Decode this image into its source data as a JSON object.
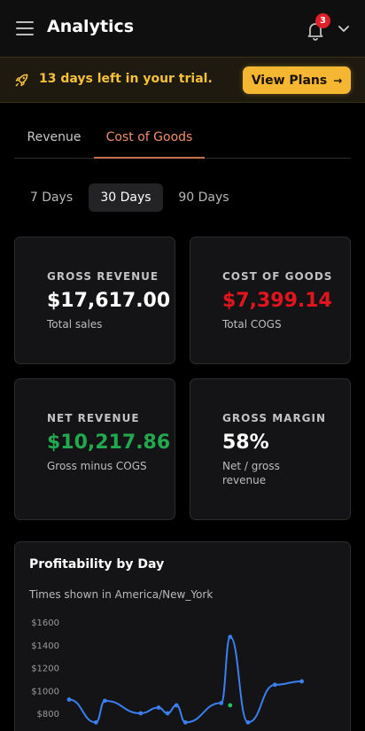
{
  "header": {
    "title": "Analytics",
    "notification_count": "3",
    "icons": {
      "menu": "menu-icon",
      "bell": "bell-icon",
      "chevron": "chevron-down-icon"
    }
  },
  "trial": {
    "message": "13 days left in your trial.",
    "button_label": "View Plans",
    "button_arrow": "→",
    "icon": "rocket-icon"
  },
  "tabs": [
    {
      "label": "Revenue",
      "active": false
    },
    {
      "label": "Cost of Goods",
      "active": true
    }
  ],
  "ranges": [
    {
      "label": "7 Days",
      "active": false
    },
    {
      "label": "30 Days",
      "active": true
    },
    {
      "label": "90 Days",
      "active": false
    }
  ],
  "metrics": [
    {
      "label": "GROSS REVENUE",
      "value": "$17,617.00",
      "sub": "Total sales"
    },
    {
      "label": "COST OF GOODS",
      "value": "$7,399.14",
      "sub": "Total COGS"
    },
    {
      "label": "NET REVENUE",
      "value": "$10,217.86",
      "sub": "Gross minus COGS"
    },
    {
      "label": "GROSS MARGIN",
      "value": "58%",
      "sub": "Net / gross revenue"
    }
  ],
  "colors": {
    "accent": "#f5b731",
    "tab_active": "#f0906a",
    "negative": "#e3141d",
    "positive": "#22a94f",
    "series_blue": "#3b7ff0",
    "series_green": "#22c55e"
  },
  "chart": {
    "title": "Profitability by Day",
    "timezone_note": "Times shown in America/New_York"
  },
  "chart_data": {
    "type": "line",
    "title": "Profitability by Day",
    "y_tick_labels": [
      "$1600",
      "$1400",
      "$1200",
      "$1000",
      "$800"
    ],
    "ylim_visible": [
      700,
      1650
    ],
    "grid": false,
    "series": [
      {
        "color": "#3b7ff0",
        "values": [
          920,
          null,
          null,
          720,
          910,
          null,
          null,
          null,
          800,
          null,
          850,
          800,
          870,
          720,
          null,
          null,
          null,
          890,
          1470,
          null,
          720,
          null,
          null,
          1050,
          null,
          null,
          1080
        ]
      },
      {
        "color": "#22c55e",
        "values": [
          null,
          null,
          null,
          null,
          null,
          null,
          null,
          null,
          null,
          null,
          null,
          null,
          null,
          null,
          null,
          null,
          null,
          null,
          870
        ]
      }
    ]
  }
}
